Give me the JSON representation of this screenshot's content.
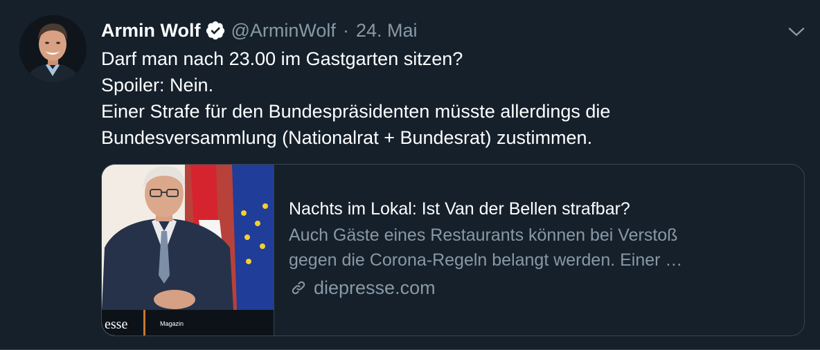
{
  "author": {
    "name": "Armin Wolf",
    "handle": "@ArminWolf",
    "separator": "·",
    "date": "24. Mai",
    "verified": true
  },
  "tweet": {
    "lines": [
      "Darf man nach 23.00 im Gastgarten sitzen?",
      "Spoiler: Nein.",
      "Einer Strafe für den Bundespräsidenten müsste allerdings die",
      "Bundesversammlung (Nationalrat + Bundesrat) zustimmen."
    ]
  },
  "card": {
    "title": "Nachts im Lokal: Ist Van der Bellen strafbar?",
    "description_lines": [
      "Auch Gäste eines Restaurants können bei Verstoß",
      "gegen die Corona-Regeln belangt werden. Einer …"
    ],
    "domain": "diepresse.com",
    "image_overlay": {
      "brand_fragment": "esse",
      "section_label": "Magazin"
    }
  },
  "icons": {
    "verified": "verified-badge-icon",
    "more": "chevron-down-icon",
    "link": "link-icon"
  },
  "colors": {
    "background": "#15202b",
    "text_primary": "#ffffff",
    "text_secondary": "#8899a6",
    "border": "#38444d",
    "verified_badge": "#ffffff"
  }
}
